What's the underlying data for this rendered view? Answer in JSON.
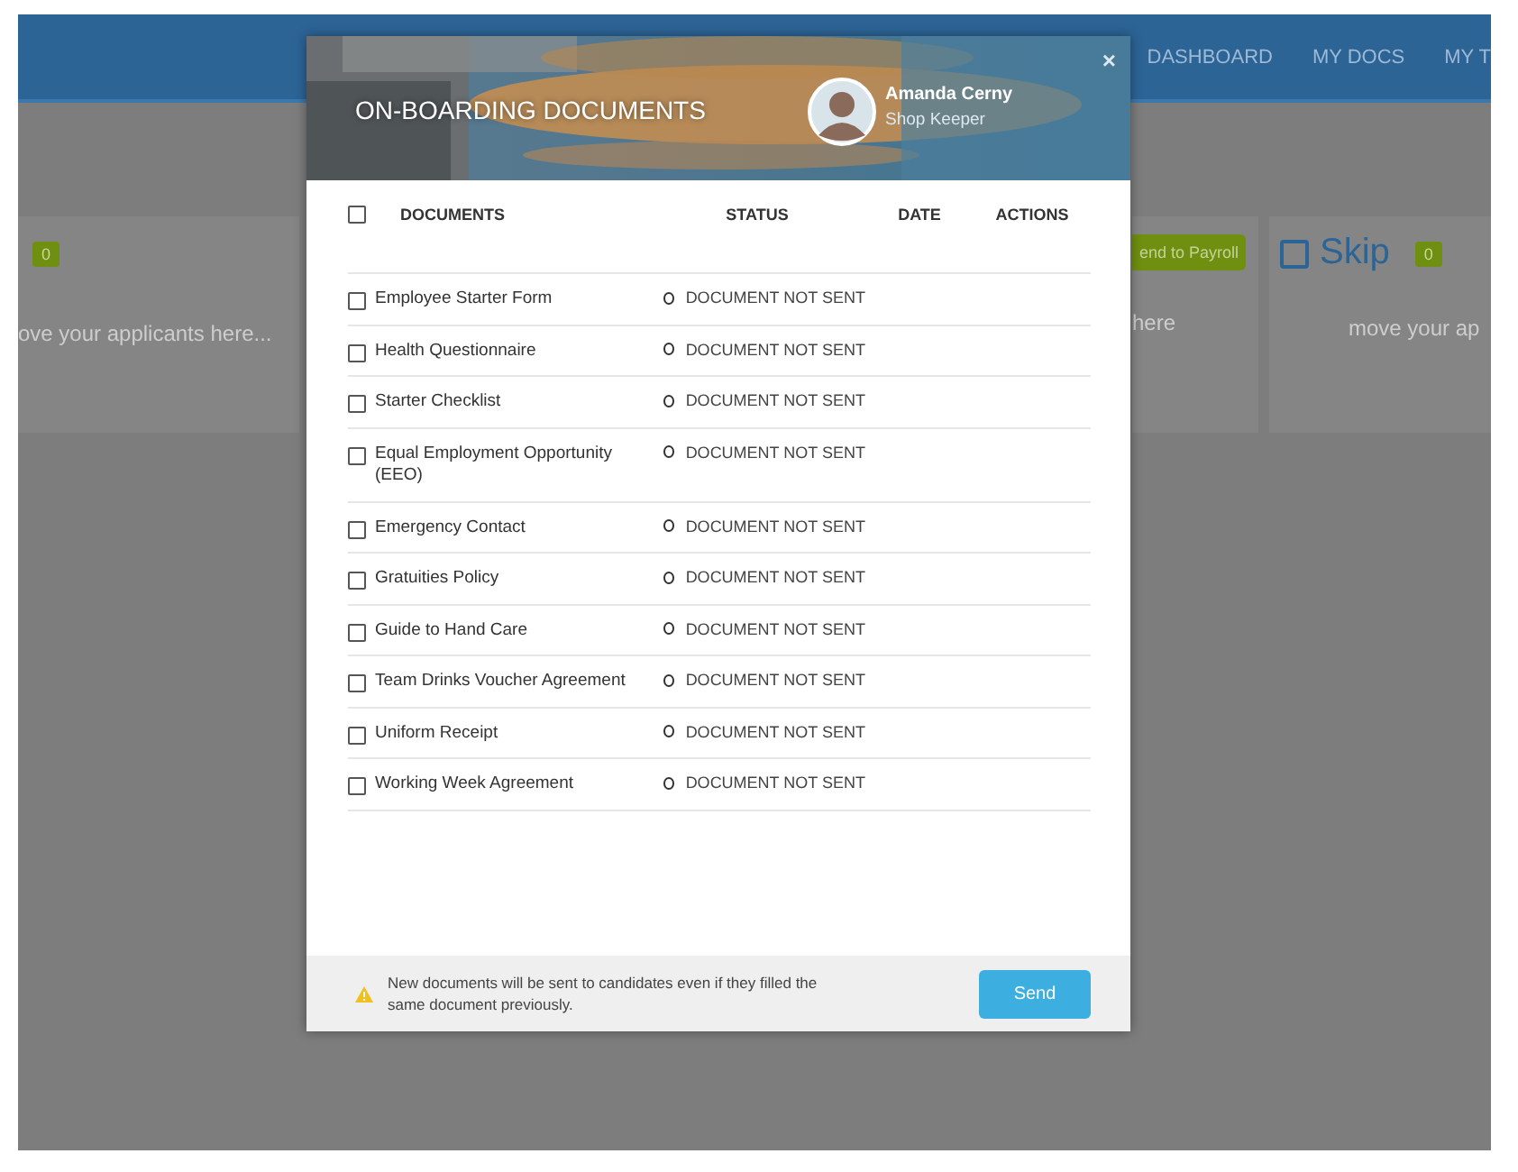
{
  "nav": {
    "links": [
      {
        "label": "DASHBOARD"
      },
      {
        "label": "MY DOCS"
      },
      {
        "label": "MY T"
      }
    ]
  },
  "board": {
    "left_card": {
      "count": "0",
      "hint": "ove your applicants here..."
    },
    "middle_card": {
      "button": "end to Payroll",
      "hint": "here"
    },
    "right_card": {
      "checked": false,
      "title": "Skip",
      "count": "0",
      "hint": "move your ap"
    }
  },
  "modal": {
    "title": "ON-BOARDING DOCUMENTS",
    "user": {
      "name": "Amanda Cerny",
      "role": "Shop Keeper"
    },
    "close": "×",
    "select_all": {
      "checked": false
    },
    "columns": [
      "DOCUMENTS",
      "STATUS",
      "DATE",
      "ACTIONS"
    ],
    "rows": [
      {
        "name": "Employee Starter Form",
        "checked": false,
        "status": "DOCUMENT NOT SENT"
      },
      {
        "name": "Health Questionnaire",
        "checked": false,
        "status": "DOCUMENT NOT SENT"
      },
      {
        "name": "Starter Checklist",
        "checked": false,
        "status": "DOCUMENT NOT SENT"
      },
      {
        "name": "Equal Employment Opportunity (EEO)",
        "checked": false,
        "status": "DOCUMENT NOT SENT"
      },
      {
        "name": "Emergency Contact",
        "checked": false,
        "status": "DOCUMENT NOT SENT"
      },
      {
        "name": "Gratuities Policy",
        "checked": false,
        "status": "DOCUMENT NOT SENT"
      },
      {
        "name": "Guide to Hand Care",
        "checked": false,
        "status": "DOCUMENT NOT SENT"
      },
      {
        "name": "Team Drinks Voucher Agreement",
        "checked": false,
        "status": "DOCUMENT NOT SENT"
      },
      {
        "name": "Uniform Receipt",
        "checked": false,
        "status": "DOCUMENT NOT SENT"
      },
      {
        "name": "Working Week Agreement",
        "checked": false,
        "status": "DOCUMENT NOT SENT"
      }
    ],
    "footer_note": "New documents will be sent to candidates even if they filled the same document previously.",
    "send_button": "Send"
  }
}
